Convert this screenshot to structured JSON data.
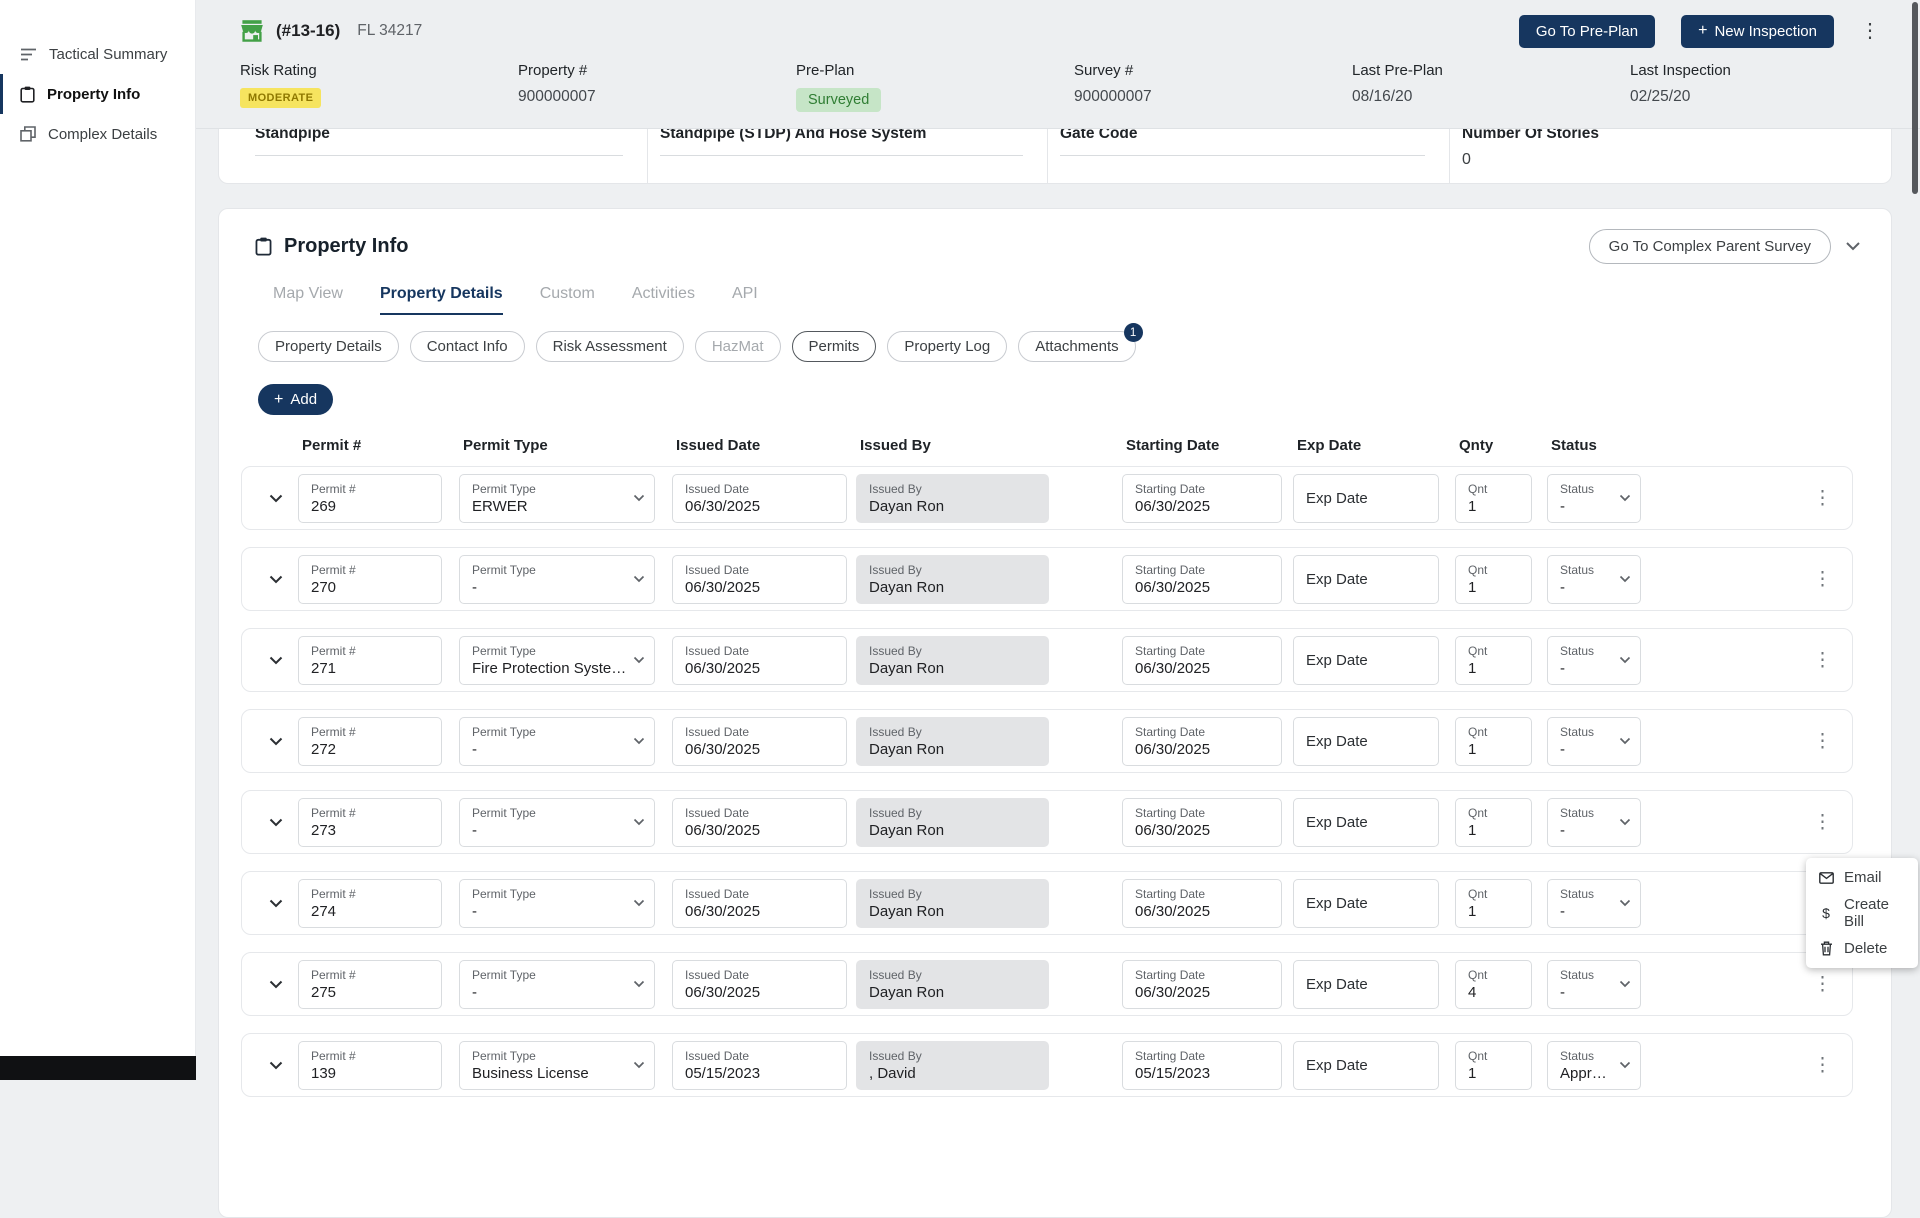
{
  "colors": {
    "navy": "#16365f",
    "green": "#43a047",
    "yellow_bg": "#f6e45f",
    "yellow_text": "#8f7800",
    "green_badge_bg": "#c6e5c7",
    "green_badge_text": "#2f7d33"
  },
  "sidebar": {
    "items": [
      {
        "label": "Tactical Summary",
        "icon": "tactical-summary-icon"
      },
      {
        "label": "Property Info",
        "icon": "property-info-icon",
        "active": true
      },
      {
        "label": "Complex Details",
        "icon": "complex-details-icon"
      }
    ]
  },
  "header": {
    "property_code": "(#13-16)",
    "property_location": "FL 34217",
    "go_to_preplan_label": "Go To Pre-Plan",
    "new_inspection_label": "New Inspection",
    "fields": [
      {
        "label": "Risk Rating",
        "value": "MODERATE",
        "badge": "yellow"
      },
      {
        "label": "Property #",
        "value": "900000007"
      },
      {
        "label": "Pre-Plan",
        "value": "Surveyed",
        "badge": "green"
      },
      {
        "label": "Survey #",
        "value": "900000007"
      },
      {
        "label": "Last Pre-Plan",
        "value": "08/16/20"
      },
      {
        "label": "Last Inspection",
        "value": "02/25/20"
      }
    ]
  },
  "clipped_section": {
    "columns": [
      {
        "label": "Standpipe",
        "value": ""
      },
      {
        "label": "Standpipe (STDP) And Hose System",
        "value": ""
      },
      {
        "label": "Gate Code",
        "value": ""
      },
      {
        "label": "Number Of Stories",
        "value": "0"
      }
    ]
  },
  "property_info": {
    "title": "Property Info",
    "go_to_complex_label": "Go To Complex Parent Survey",
    "tabs": [
      {
        "label": "Map View",
        "disabled": true
      },
      {
        "label": "Property Details",
        "active": true
      },
      {
        "label": "Custom",
        "disabled": true
      },
      {
        "label": "Activities",
        "disabled": true
      },
      {
        "label": "API",
        "disabled": true
      }
    ],
    "subtabs": [
      {
        "label": "Property Details"
      },
      {
        "label": "Contact Info"
      },
      {
        "label": "Risk Assessment"
      },
      {
        "label": "HazMat",
        "disabled": true
      },
      {
        "label": "Permits",
        "selected": true
      },
      {
        "label": "Property Log"
      },
      {
        "label": "Attachments",
        "badge": "1"
      }
    ],
    "add_label": "Add",
    "table": {
      "headers": [
        "Permit #",
        "Permit Type",
        "Issued Date",
        "Issued By",
        "Starting Date",
        "Exp Date",
        "Qnty",
        "Status"
      ],
      "field_labels": {
        "permit": "Permit #",
        "type": "Permit Type",
        "issued": "Issued Date",
        "issued_by": "Issued By",
        "starting": "Starting Date",
        "exp": "Exp Date",
        "qnt": "Qnt",
        "status": "Status"
      },
      "rows": [
        {
          "permit": "269",
          "type": "ERWER",
          "issued": "06/30/2025",
          "issued_by": "Dayan Ron",
          "starting": "06/30/2025",
          "qnt": "1",
          "status": "-"
        },
        {
          "permit": "270",
          "type": "-",
          "issued": "06/30/2025",
          "issued_by": "Dayan Ron",
          "starting": "06/30/2025",
          "qnt": "1",
          "status": "-"
        },
        {
          "permit": "271",
          "type": "Fire Protection Systems P...",
          "issued": "06/30/2025",
          "issued_by": "Dayan Ron",
          "starting": "06/30/2025",
          "qnt": "1",
          "status": "-"
        },
        {
          "permit": "272",
          "type": "-",
          "issued": "06/30/2025",
          "issued_by": "Dayan Ron",
          "starting": "06/30/2025",
          "qnt": "1",
          "status": "-"
        },
        {
          "permit": "273",
          "type": "-",
          "issued": "06/30/2025",
          "issued_by": "Dayan Ron",
          "starting": "06/30/2025",
          "qnt": "1",
          "status": "-"
        },
        {
          "permit": "274",
          "type": "-",
          "issued": "06/30/2025",
          "issued_by": "Dayan Ron",
          "starting": "06/30/2025",
          "qnt": "1",
          "status": "-"
        },
        {
          "permit": "275",
          "type": "-",
          "issued": "06/30/2025",
          "issued_by": "Dayan Ron",
          "starting": "06/30/2025",
          "qnt": "4",
          "status": "-"
        },
        {
          "permit": "139",
          "type": "Business License",
          "issued": "05/15/2023",
          "issued_by": ", David",
          "starting": "05/15/2023",
          "qnt": "1",
          "status": "Approved"
        }
      ]
    }
  },
  "context_menu": {
    "items": [
      {
        "label": "Email",
        "icon": "email-icon"
      },
      {
        "label": "Create Bill",
        "icon": "dollar-icon"
      },
      {
        "label": "Delete",
        "icon": "trash-icon"
      }
    ]
  }
}
